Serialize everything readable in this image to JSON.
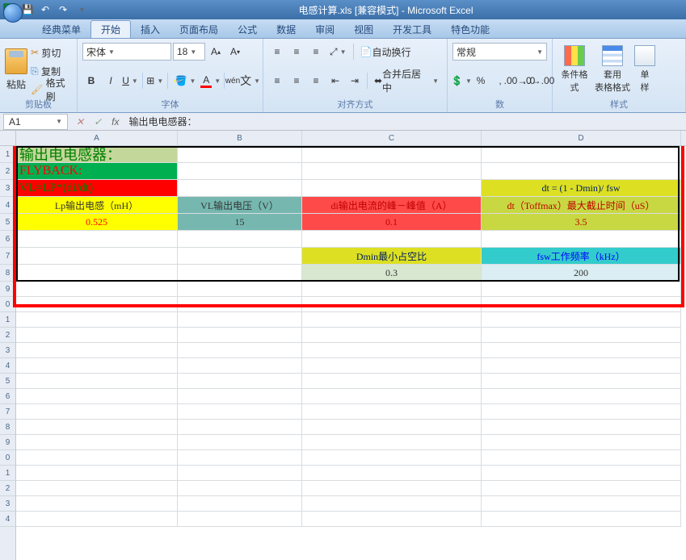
{
  "window": {
    "title": "电感计算.xls [兼容模式] - Microsoft Excel"
  },
  "qat": {
    "save": "save-icon",
    "undo": "undo-icon",
    "redo": "redo-icon"
  },
  "tabs": [
    {
      "label": "经典菜单"
    },
    {
      "label": "开始",
      "active": true
    },
    {
      "label": "插入"
    },
    {
      "label": "页面布局"
    },
    {
      "label": "公式"
    },
    {
      "label": "数据"
    },
    {
      "label": "审阅"
    },
    {
      "label": "视图"
    },
    {
      "label": "开发工具"
    },
    {
      "label": "特色功能"
    }
  ],
  "ribbon": {
    "clipboard": {
      "paste": "粘贴",
      "cut": "剪切",
      "copy": "复制",
      "format_painter": "格式刷",
      "group": "剪贴板"
    },
    "font": {
      "name": "宋体",
      "size": "18",
      "group": "字体",
      "bold": "B",
      "italic": "I",
      "underline": "U"
    },
    "align": {
      "wrap": "自动换行",
      "merge": "合并后居中",
      "group": "对齐方式"
    },
    "number": {
      "format": "常规",
      "group": "数"
    },
    "styles": {
      "cond": "条件格式",
      "table": "套用\n表格格式",
      "cell": "单\n样",
      "group": "样式"
    }
  },
  "formula_bar": {
    "name_box": "A1",
    "fx": "fx",
    "formula": "输出电电感器："
  },
  "columns": {
    "A": 200,
    "B": 154,
    "C": 222,
    "D": 247
  },
  "rows": [
    1,
    2,
    3,
    4,
    5,
    6,
    7,
    8,
    9,
    0,
    1,
    2,
    3,
    4,
    5,
    6,
    7,
    8,
    9,
    0,
    1,
    2,
    3,
    4
  ],
  "cells": {
    "A1": {
      "v": "输出电电感器：",
      "cls": "bg-lime bg-greentxt",
      "size": "18px"
    },
    "A2": {
      "v": "FLYBACK:",
      "cls": "bg-green"
    },
    "A3": {
      "v": "VL=LP*(di/dt)",
      "cls": "bg-red"
    },
    "D3": {
      "v": "dt = (1 - Dmin)/ fsw",
      "cls": "bg-darkyellow bg-navy-text center"
    },
    "A4": {
      "v": "Lp输出电感（mH）",
      "cls": "bg-yellow center"
    },
    "B4": {
      "v": "VL输出电压（V）",
      "cls": "bg-teal center"
    },
    "C4": {
      "v": "di输出电流的峰－峰值（A）",
      "cls": "bg-red2 center"
    },
    "D4": {
      "v": "dt（Toffmax）最大截止时间（uS）",
      "cls": "bg-olive2 center"
    },
    "A5": {
      "v": "0.525",
      "cls": "bg-yellow center",
      "color": "#ff0000"
    },
    "B5": {
      "v": "15",
      "cls": "bg-teal center"
    },
    "C5": {
      "v": "0.1",
      "cls": "bg-red2 center"
    },
    "D5": {
      "v": "3.5",
      "cls": "bg-olive2 center"
    },
    "C7": {
      "v": "Dmin最小占空比",
      "cls": "bg-darkyellow bg-navy-text center"
    },
    "D7": {
      "v": "fsw工作频率（kHz）",
      "cls": "bg-cyan center"
    },
    "C8": {
      "v": "0.3",
      "cls": "bg-pale center"
    },
    "D8": {
      "v": "200",
      "cls": "bg-pale2 center"
    }
  }
}
